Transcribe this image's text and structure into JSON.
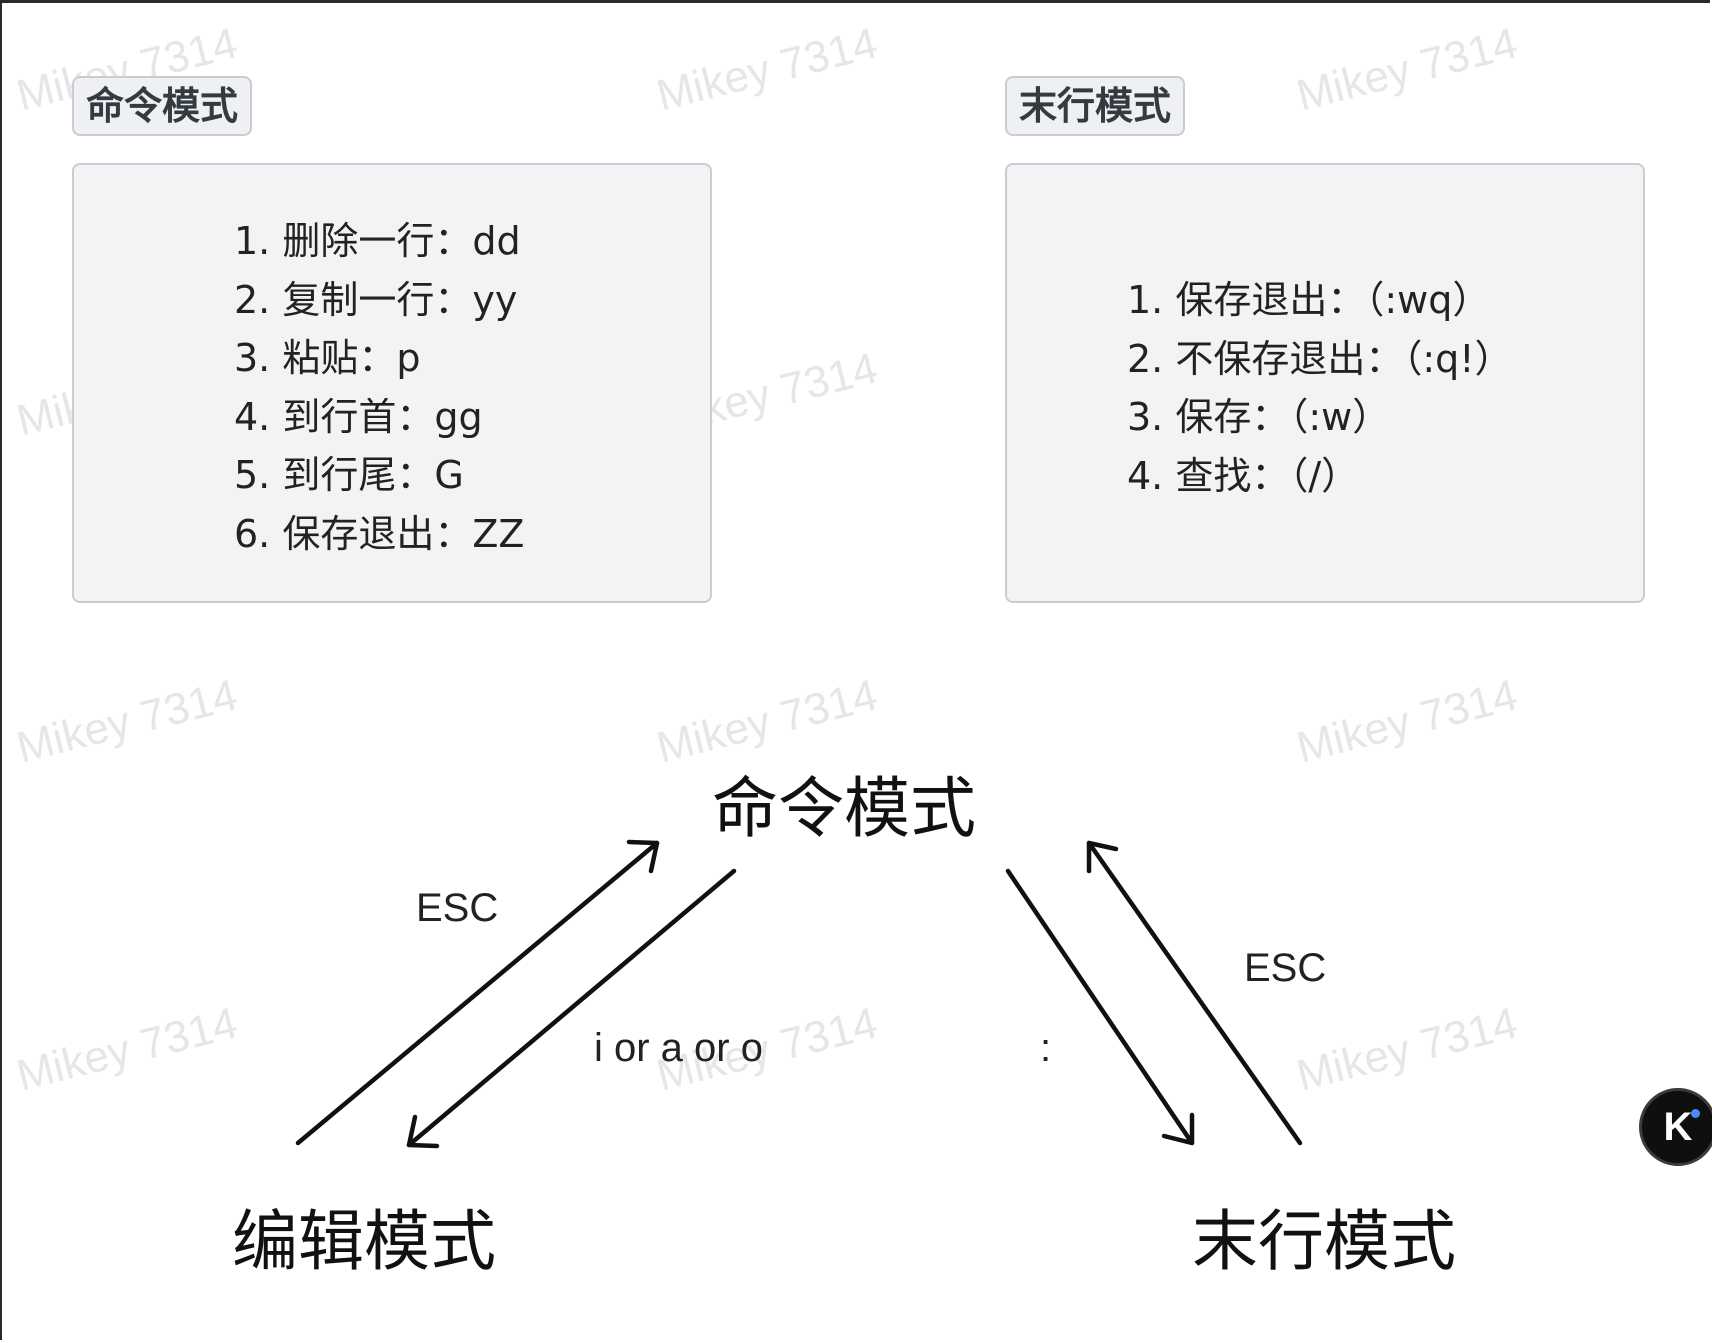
{
  "watermark": "Mikey 7314",
  "command_panel": {
    "title": "命令模式",
    "items": [
      "1. 删除一行：dd",
      "2. 复制一行：yy",
      "3. 粘贴：p",
      "4. 到行首：gg",
      "5. 到行尾：G",
      "6. 保存退出：ZZ"
    ]
  },
  "lastline_panel": {
    "title": "末行模式",
    "items": [
      "1. 保存退出：（:wq）",
      "2. 不保存退出：（:q!）",
      "3. 保存：（:w）",
      "4. 查找：（/）"
    ]
  },
  "diagram": {
    "nodes": {
      "command": "命令模式",
      "edit": "编辑模式",
      "lastline": "末行模式"
    },
    "edges": {
      "edit_to_command": "ESC",
      "command_to_edit": "i or a or o",
      "command_to_lastline": ":",
      "lastline_to_command": "ESC"
    }
  },
  "badge": {
    "icon": "k-logo-icon",
    "dot_color": "#4a8cff"
  }
}
